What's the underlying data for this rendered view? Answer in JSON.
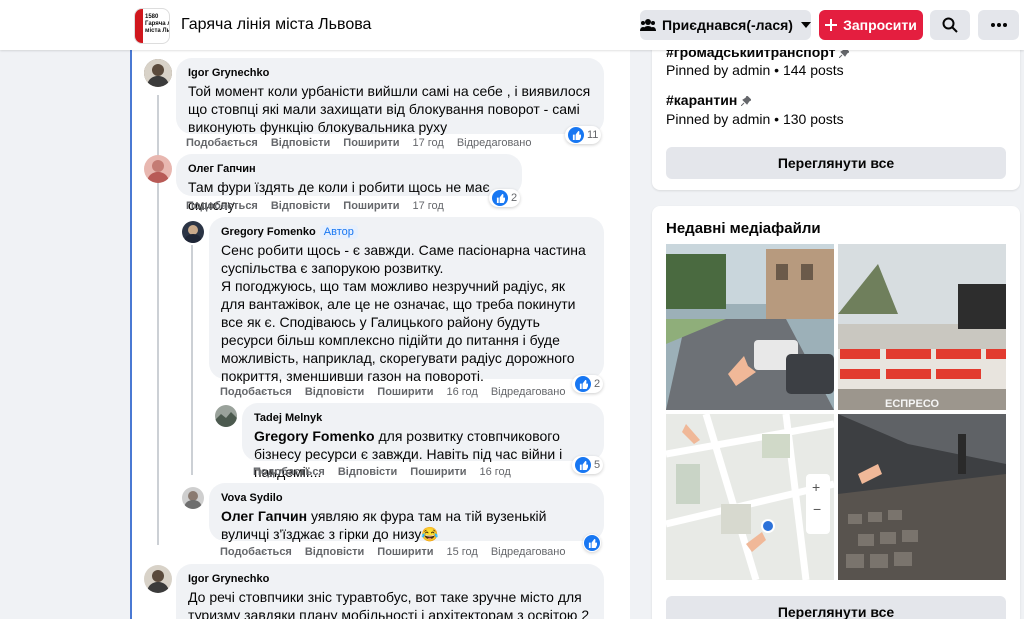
{
  "header": {
    "logo_text": "1580\nГаряча л\nміста Ль",
    "group_title": "Гаряча лінія міста Львова",
    "join_label": "Приєднався(-лася)",
    "invite_label": "Запросити",
    "icons": [
      "group-icon",
      "chevron-down-icon",
      "plus-icon",
      "search-icon",
      "more-icon"
    ]
  },
  "comments": [
    {
      "name": "Igor Grynechko",
      "text": "Той момент коли урбаністи вийшли самі на себе , і виявилося що стовпці які мали захищати від блокування поворот - самі виконують функцію блокувальника руху",
      "like": "Подобається",
      "reply": "Відповісти",
      "share": "Поширити",
      "time": "17 год",
      "edited": "Відредаговано",
      "reactions": "11"
    },
    {
      "name": "Олег Гапчин",
      "text": "Там фури їздять де коли і робити щось не має смислу",
      "like": "Подобається",
      "reply": "Відповісти",
      "share": "Поширити",
      "time": "17 год",
      "reactions": "2"
    },
    {
      "name": "Gregory Fomenko",
      "badge": "Автор",
      "text": "Сенс робити щось - є завжди. Саме пасіонарна частина суспільства є запорукою розвитку.\nЯ погоджуюсь, що там можливо незручний радіус, як для вантажівок, але це не означає, що треба покинути все як є. Сподіваюсь у Галицького району будуть ресурси більш комплексно підійти до питання і буде можливість, наприклад, скорегувати радіус дорожного покриття, зменшивши газон на повороті.",
      "like": "Подобається",
      "reply": "Відповісти",
      "share": "Поширити",
      "time": "16 год",
      "edited": "Відредаговано",
      "reactions": "2"
    },
    {
      "name": "Tadej Melnyk",
      "mention": "Gregory Fomenko",
      "text": " для розвитку стовпчикового бізнесу ресурси є завжди. Навіть під час війни і пандемії...",
      "like": "Подобається",
      "reply": "Відповісти",
      "share": "Поширити",
      "time": "16 год",
      "reactions": "5"
    },
    {
      "name": "Vova Sydilo",
      "mention": "Олег Гапчин",
      "text": " уявляю як фура там на тій вузенькій вуличці з'їзджає з гірки до низу😂",
      "like": "Подобається",
      "reply": "Відповісти",
      "share": "Поширити",
      "time": "15 год",
      "edited": "Відредаговано",
      "reactions": ""
    },
    {
      "name": "Igor Grynechko",
      "text": "До речі стовпчики зніс туравтобус, вот таке зручне місто для туризму завдяки плану мобільності і архітекторам з освітою 2"
    }
  ],
  "sidebar": {
    "topics": [
      {
        "tag": "#громадськийтранспорт",
        "meta": "Pinned by admin • 144 posts"
      },
      {
        "tag": "#карантин",
        "meta": "Pinned by admin • 130 posts"
      }
    ],
    "view_all_label": "Переглянути все",
    "media_title": "Недавні медіафайли",
    "media_watermark": "ЕСПРЕСО",
    "media_view_all_label": "Переглянути все"
  },
  "colors": {
    "accent": "#1877f2",
    "invite": "#e41e3f",
    "bubble": "#f0f2f5",
    "feed_border": "#4a79d3"
  }
}
